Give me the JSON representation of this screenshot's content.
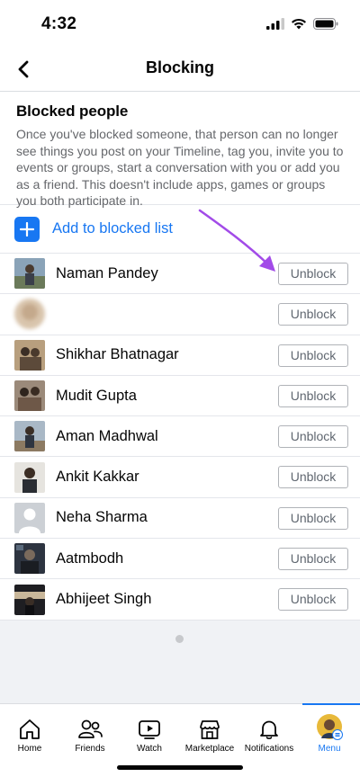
{
  "status": {
    "time": "4:32"
  },
  "header": {
    "title": "Blocking"
  },
  "blocked": {
    "title": "Blocked people",
    "description": "Once you've blocked someone, that person can no longer see things you post on your Timeline, tag you, invite you to events or groups, start a conversation with you or add you as a friend. This doesn't include apps, games or groups you both participate in.",
    "add_label": "Add to blocked list",
    "unblock_label": "Unblock",
    "people": [
      {
        "name": "Naman Pandey"
      },
      {
        "name": ""
      },
      {
        "name": "Shikhar Bhatnagar"
      },
      {
        "name": "Mudit Gupta"
      },
      {
        "name": "Aman Madhwal"
      },
      {
        "name": "Ankit Kakkar"
      },
      {
        "name": "Neha Sharma"
      },
      {
        "name": "Aatmbodh"
      },
      {
        "name": "Abhijeet Singh"
      }
    ]
  },
  "tabs": [
    {
      "label": "Home",
      "icon": "home-icon"
    },
    {
      "label": "Friends",
      "icon": "friends-icon"
    },
    {
      "label": "Watch",
      "icon": "watch-icon"
    },
    {
      "label": "Marketplace",
      "icon": "marketplace-icon"
    },
    {
      "label": "Notifications",
      "icon": "bell-icon"
    },
    {
      "label": "Menu",
      "icon": "profile-avatar",
      "active": true
    }
  ],
  "colors": {
    "accent": "#1877f2",
    "annotation_arrow": "#a24be8"
  }
}
